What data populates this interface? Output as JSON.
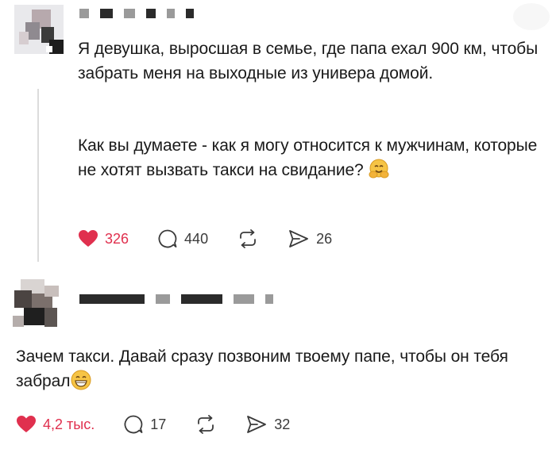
{
  "post": {
    "paragraphs": [
      "Я девушка, выросшая в семье, где папа ехал 900 км, чтобы забрать меня на выходные из универа домой.",
      "Как вы думаете - как я могу относится к мужчинам, которые не хотят вызвать такси на свидание?"
    ],
    "likes": "326",
    "comments": "440",
    "shares": "26"
  },
  "reply": {
    "text": "Зачем такси. Давай сразу позвоним твоему папе, чтобы он тебя забрал",
    "likes": "4,2 тыс.",
    "comments": "17",
    "shares": "32"
  },
  "icons": {
    "like": "heart-icon",
    "comment": "comment-bubble-icon",
    "repost": "repost-icon",
    "share": "send-icon",
    "emoji_post": "hugging-face-emoji",
    "emoji_reply": "grinning-face-emoji"
  },
  "colors": {
    "like": "#e0304e",
    "text": "#1a1a1a",
    "icon": "#3a3a3a"
  }
}
